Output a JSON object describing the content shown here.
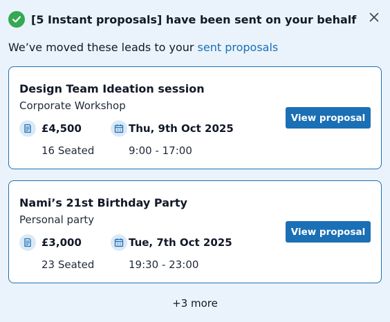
{
  "header": {
    "title": "[5 Instant proposals] have been sent on your behalf",
    "check_icon": "check-circle-icon",
    "close_icon": "close-icon",
    "accent_color": "#34a853"
  },
  "subtitle": {
    "text": "We’ve moved these leads to your ",
    "link": "sent proposals",
    "link_color": "#1a6fb5"
  },
  "proposals": [
    {
      "title": "Design Team Ideation session",
      "type": "Corporate Workshop",
      "price": "£4,500",
      "seated": "16 Seated",
      "date": "Thu, 9th Oct 2025",
      "time": "9:00 - 17:00",
      "button": "View proposal"
    },
    {
      "title": "Nami’s 21st Birthday Party",
      "type": "Personal party",
      "price": "£3,000",
      "seated": "23 Seated",
      "date": "Tue, 7th Oct 2025",
      "time": "19:30 - 23:00",
      "button": "View proposal"
    }
  ],
  "more": "+3 more",
  "colors": {
    "background": "#eaf3fb",
    "card_border": "#1a6fb5",
    "button": "#1a6fb5",
    "icon_bubble": "#dbe9f6"
  }
}
